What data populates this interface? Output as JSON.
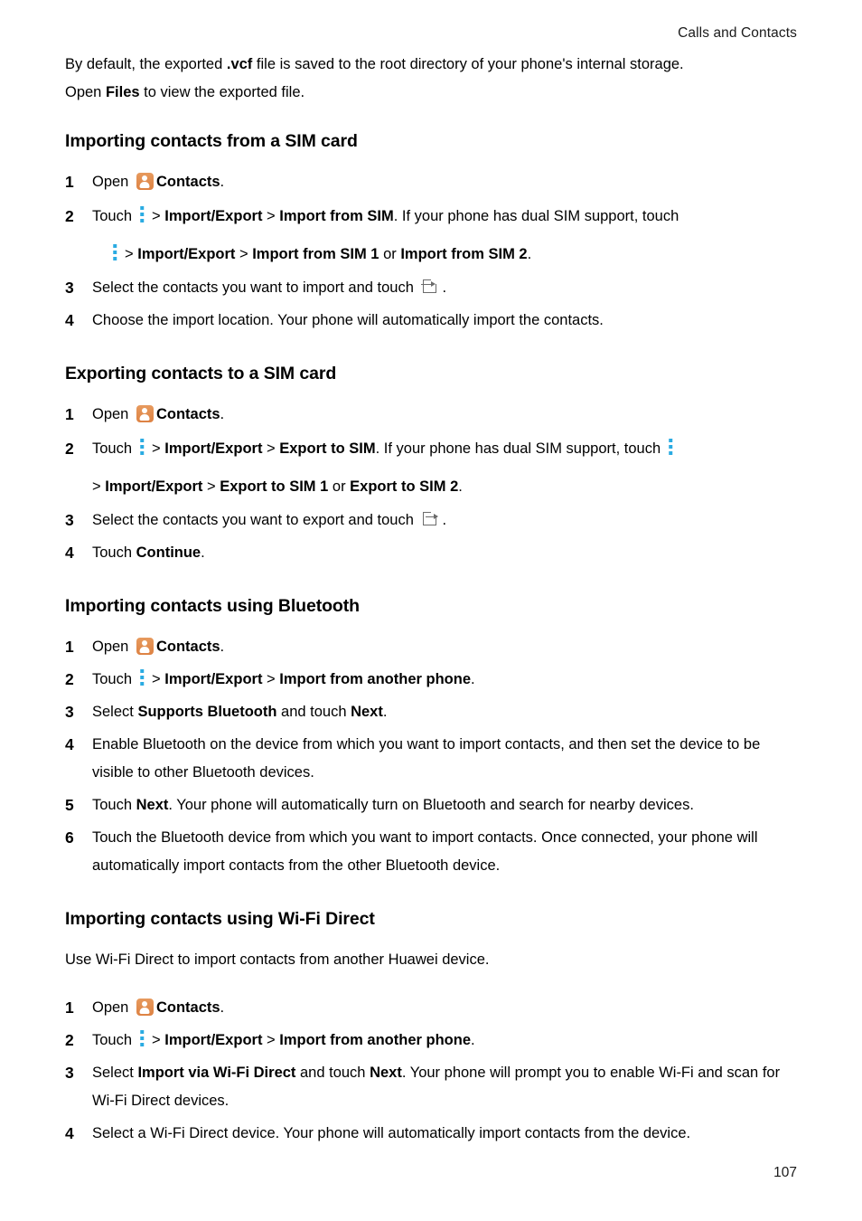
{
  "header": {
    "chapter": "Calls and Contacts"
  },
  "intro": {
    "line1_a": "By default, the exported ",
    "line1_b": ".vcf",
    "line1_c": " file is saved to the root directory of your phone's internal storage.",
    "line2_a": "Open ",
    "line2_b": "Files",
    "line2_c": " to view the exported file."
  },
  "sections": [
    {
      "title": "Importing contacts from a SIM card",
      "steps": [
        {
          "num": "1",
          "parts": [
            "Open ",
            "[contacts-icon]",
            "Contacts",
            "."
          ]
        },
        {
          "num": "2",
          "t_touch": "Touch",
          "t_gt1": "> ",
          "t_import_export": "Import/Export",
          "t_gt2": " > ",
          "t_target": "Import from SIM",
          "t_tail": ". If your phone has dual SIM support, touch",
          "c_gt1": "> ",
          "c_import_export": "Import/Export",
          "c_gt2": " > ",
          "c_target1": "Import from SIM 1",
          "c_or": " or ",
          "c_target2": "Import from SIM 2",
          "c_period": "."
        },
        {
          "num": "3",
          "text_a": "Select the contacts you want to import and touch ",
          "icon": "import-icon",
          "text_b": "."
        },
        {
          "num": "4",
          "text": "Choose the import location. Your phone will automatically import the contacts."
        }
      ]
    },
    {
      "title": "Exporting contacts to a SIM card",
      "steps": [
        {
          "num": "1",
          "parts": [
            "Open ",
            "[contacts-icon]",
            "Contacts",
            "."
          ]
        },
        {
          "num": "2",
          "t_touch": "Touch",
          "t_gt1": "> ",
          "t_import_export": "Import/Export",
          "t_gt2": " > ",
          "t_target": "Export to SIM",
          "t_tail": ". If your phone has dual SIM support, touch",
          "c_gt1": "> ",
          "c_import_export": "Import/Export",
          "c_gt2": " > ",
          "c_target1": "Export to SIM 1",
          "c_or": " or ",
          "c_target2": "Export to SIM 2",
          "c_period": "."
        },
        {
          "num": "3",
          "text_a": "Select the contacts you want to export and touch ",
          "icon": "export-icon",
          "text_b": "."
        },
        {
          "num": "4",
          "text_a": "Touch ",
          "bold": "Continue",
          "text_b": "."
        }
      ]
    },
    {
      "title": "Importing contacts using Bluetooth",
      "steps": [
        {
          "num": "1",
          "parts": [
            "Open ",
            "[contacts-icon]",
            "Contacts",
            "."
          ]
        },
        {
          "num": "2",
          "t_touch": "Touch",
          "t_gt1": "> ",
          "t_import_export": "Import/Export",
          "t_gt2": " > ",
          "t_target": "Import from another phone",
          "t_tail": "."
        },
        {
          "num": "3",
          "a": "Select ",
          "b1": "Supports Bluetooth",
          "c": " and touch ",
          "b2": "Next",
          "d": "."
        },
        {
          "num": "4",
          "text": "Enable Bluetooth on the device from which you want to import contacts, and then set the device to be visible to other Bluetooth devices."
        },
        {
          "num": "5",
          "a": "Touch ",
          "b1": "Next",
          "c": ". Your phone will automatically turn on Bluetooth and search for nearby devices."
        },
        {
          "num": "6",
          "text": "Touch the Bluetooth device from which you want to import contacts. Once connected, your phone will automatically import contacts from the other Bluetooth device."
        }
      ]
    },
    {
      "title": "Importing contacts using Wi-Fi Direct",
      "intro": "Use Wi-Fi Direct to import contacts from another Huawei device.",
      "steps": [
        {
          "num": "1",
          "parts": [
            "Open ",
            "[contacts-icon]",
            "Contacts",
            "."
          ]
        },
        {
          "num": "2",
          "t_touch": "Touch",
          "t_gt1": "> ",
          "t_import_export": "Import/Export",
          "t_gt2": " > ",
          "t_target": "Import from another phone",
          "t_tail": "."
        },
        {
          "num": "3",
          "a": "Select ",
          "b1": "Import via Wi-Fi Direct",
          "c": " and touch ",
          "b2": "Next",
          "d": ". Your phone will prompt you to enable Wi-Fi and scan for Wi-Fi Direct devices."
        },
        {
          "num": "4",
          "text": "Select a Wi-Fi Direct device. Your phone will automatically import contacts from the device."
        }
      ]
    }
  ],
  "footer": {
    "page_number": "107"
  },
  "colors": {
    "contacts_icon_orange": "#dd8243",
    "overflow_dots_blue": "#2aabe2",
    "icon_outline_gray": "#6b6b6b",
    "text_black": "#000000"
  }
}
